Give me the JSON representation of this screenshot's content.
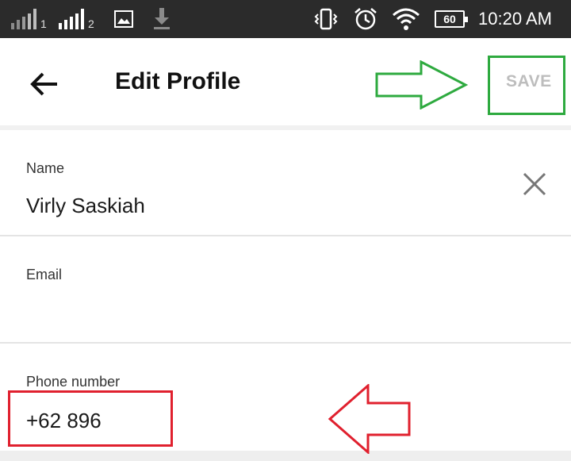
{
  "status_bar": {
    "sim1_label": "1",
    "sim2_label": "2",
    "icons": [
      "signal-sim1-icon",
      "signal-sim2-icon",
      "image-notification-icon",
      "download-icon",
      "vibrate-icon",
      "alarm-icon",
      "wifi-icon",
      "battery-icon"
    ],
    "battery_level": "60",
    "time": "10:20 AM"
  },
  "app_bar": {
    "back_icon": "arrow-back-icon",
    "title": "Edit Profile",
    "save_label": "SAVE"
  },
  "form": {
    "name": {
      "label": "Name",
      "value": "Virly Saskiah",
      "clear_icon": "close-icon"
    },
    "email": {
      "label": "Email",
      "value": ""
    },
    "phone": {
      "label": "Phone number",
      "value": "+62  896"
    }
  },
  "colors": {
    "status_bar_bg": "#2b2b2b",
    "save_disabled": "#bdbdbd",
    "annotation_green": "#2eaa3f",
    "annotation_red": "#e0202e"
  }
}
